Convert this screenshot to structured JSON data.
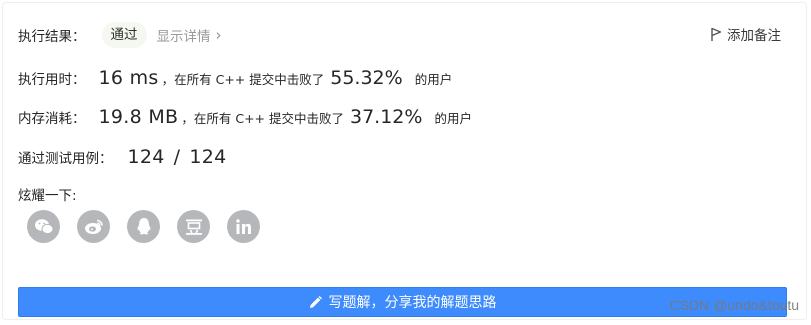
{
  "result": {
    "label": "执行结果：",
    "status": "通过",
    "details_link": "显示详情",
    "chevron": "›",
    "add_note": "添加备注"
  },
  "runtime": {
    "label": "执行用时：",
    "value": "16 ms",
    "prefix": "，在所有 C++ 提交中击败了",
    "percent": "55.32%",
    "suffix": "的用户"
  },
  "memory": {
    "label": "内存消耗：",
    "value": "19.8 MB",
    "prefix": "，在所有 C++ 提交中击败了",
    "percent": "37.12%",
    "suffix": "的用户"
  },
  "tests": {
    "label": "通过测试用例：",
    "passed": "124",
    "separator": "/",
    "total": "124"
  },
  "share": {
    "label": "炫耀一下:",
    "icons": [
      "wechat-icon",
      "weibo-icon",
      "qq-icon",
      "douban-icon",
      "linkedin-icon"
    ]
  },
  "cta": {
    "label": "写题解，分享我的解题思路"
  },
  "watermark": "CSDN @undo&toutu",
  "colors": {
    "primary": "#3d8bfd",
    "icon_gray": "#b5b7ba",
    "pill_bg": "#f5f8f0"
  }
}
